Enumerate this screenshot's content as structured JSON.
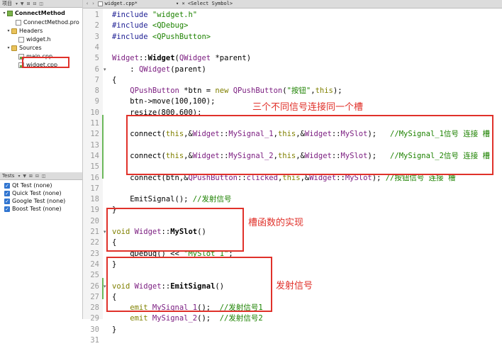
{
  "projects_panel": {
    "header_title": "项目",
    "tree": [
      {
        "label": "ConnectMethod",
        "kind": "project",
        "bold": true,
        "arrow": "▾"
      },
      {
        "label": "ConnectMethod.pro",
        "kind": "file",
        "arrow": ""
      },
      {
        "label": "Headers",
        "kind": "folder",
        "arrow": "▾"
      },
      {
        "label": "widget.h",
        "kind": "file",
        "arrow": ""
      },
      {
        "label": "Sources",
        "kind": "folder",
        "arrow": "▾"
      },
      {
        "label": "main.cpp",
        "kind": "cpp",
        "arrow": ""
      },
      {
        "label": "widget.cpp",
        "kind": "cpp",
        "arrow": "",
        "selected": true
      }
    ]
  },
  "tests_panel": {
    "header_title": "Tests",
    "items": [
      {
        "label": "Qt Test (none)"
      },
      {
        "label": "Quick Test (none)"
      },
      {
        "label": "Google Test (none)"
      },
      {
        "label": "Boost Test (none)"
      }
    ]
  },
  "editor": {
    "filename": "widget.cpp*",
    "symbol_selector": "<Select Symbol>",
    "close_glyph": "×",
    "lines": [
      [
        [
          "#include ",
          "#1d1e93"
        ],
        [
          "\"widget.h\"",
          "#1d8200"
        ]
      ],
      [
        [
          "#include ",
          "#1d1e93"
        ],
        [
          "<QDebug>",
          "#1d8200"
        ]
      ],
      [
        [
          "#include ",
          "#1d1e93"
        ],
        [
          "<QPushButton>",
          "#1d8200"
        ]
      ],
      [
        [
          "",
          ""
        ]
      ],
      [
        [
          "Widget",
          "#7a1b7f"
        ],
        [
          "::",
          "#000"
        ],
        [
          "Widget",
          "#000",
          "bold"
        ],
        [
          "(",
          "#000"
        ],
        [
          "QWidget",
          "#7a1b7f"
        ],
        [
          " *parent)",
          "#000"
        ]
      ],
      [
        [
          "    : ",
          "#000"
        ],
        [
          "QWidget",
          "#7a1b7f"
        ],
        [
          "(parent)",
          "#000"
        ]
      ],
      [
        [
          "{",
          "#000"
        ]
      ],
      [
        [
          "    ",
          "#000"
        ],
        [
          "QPushButton",
          "#7a1b7f"
        ],
        [
          " *btn = ",
          "#000"
        ],
        [
          "new ",
          "#808000"
        ],
        [
          "QPushButton",
          "#7a1b7f"
        ],
        [
          "(",
          "#000"
        ],
        [
          "\"按钮\"",
          "#1d8200"
        ],
        [
          ",",
          "#000"
        ],
        [
          "this",
          "#808000"
        ],
        [
          ");",
          "#000"
        ]
      ],
      [
        [
          "    btn->move(100,100);",
          "#000"
        ]
      ],
      [
        [
          "    resize(800,600);",
          "#000"
        ]
      ],
      [
        [
          "",
          ""
        ]
      ],
      [
        [
          "    connect(",
          "#000"
        ],
        [
          "this",
          "#808000"
        ],
        [
          ",&",
          "#000"
        ],
        [
          "Widget",
          "#7a1b7f"
        ],
        [
          "::",
          "#000"
        ],
        [
          "MySignal_1",
          "#7a1b7f"
        ],
        [
          ",",
          "#000"
        ],
        [
          "this",
          "#808000"
        ],
        [
          ",&",
          "#000"
        ],
        [
          "Widget",
          "#7a1b7f"
        ],
        [
          "::",
          "#000"
        ],
        [
          "MySlot",
          "#7a1b7f"
        ],
        [
          ");   ",
          "#000"
        ],
        [
          "//MySignal_1信号 连接 槽",
          "#1d8200"
        ]
      ],
      [
        [
          "",
          ""
        ]
      ],
      [
        [
          "    connect(",
          "#000"
        ],
        [
          "this",
          "#808000"
        ],
        [
          ",&",
          "#000"
        ],
        [
          "Widget",
          "#7a1b7f"
        ],
        [
          "::",
          "#000"
        ],
        [
          "MySignal_2",
          "#7a1b7f"
        ],
        [
          ",",
          "#000"
        ],
        [
          "this",
          "#808000"
        ],
        [
          ",&",
          "#000"
        ],
        [
          "Widget",
          "#7a1b7f"
        ],
        [
          "::",
          "#000"
        ],
        [
          "MySlot",
          "#7a1b7f"
        ],
        [
          ");   ",
          "#000"
        ],
        [
          "//MySignal_2信号 连接 槽",
          "#1d8200"
        ]
      ],
      [
        [
          "",
          ""
        ]
      ],
      [
        [
          "    connect(btn,&",
          "#000"
        ],
        [
          "QPushButton",
          "#7a1b7f"
        ],
        [
          "::",
          "#000"
        ],
        [
          "clicked",
          "#7a1b7f"
        ],
        [
          ",",
          "#000"
        ],
        [
          "this",
          "#808000"
        ],
        [
          ",&",
          "#000"
        ],
        [
          "Widget",
          "#7a1b7f"
        ],
        [
          "::",
          "#000"
        ],
        [
          "MySlot",
          "#7a1b7f"
        ],
        [
          "); ",
          "#000"
        ],
        [
          "//按钮信号 连接 槽",
          "#1d8200"
        ]
      ],
      [
        [
          "",
          ""
        ]
      ],
      [
        [
          "    EmitSignal(); ",
          "#000"
        ],
        [
          "//发射信号",
          "#1d8200"
        ]
      ],
      [
        [
          "}",
          "#000"
        ]
      ],
      [
        [
          "",
          ""
        ]
      ],
      [
        [
          "void ",
          "#808000"
        ],
        [
          "Widget",
          "#7a1b7f"
        ],
        [
          "::",
          "#000"
        ],
        [
          "MySlot",
          "#000",
          "bold"
        ],
        [
          "()",
          "#000"
        ]
      ],
      [
        [
          "{",
          "#000"
        ]
      ],
      [
        [
          "    qDebug() << ",
          "#000"
        ],
        [
          "\"MySlot_1\"",
          "#1d8200"
        ],
        [
          ";",
          "#000"
        ]
      ],
      [
        [
          "}",
          "#000"
        ]
      ],
      [
        [
          "",
          ""
        ]
      ],
      [
        [
          "void ",
          "#808000"
        ],
        [
          "Widget",
          "#7a1b7f"
        ],
        [
          "::",
          "#000"
        ],
        [
          "EmitSignal",
          "#000",
          "bold"
        ],
        [
          "()",
          "#000"
        ]
      ],
      [
        [
          "{",
          "#000"
        ]
      ],
      [
        [
          "    emit ",
          "#808000"
        ],
        [
          "MySignal_1",
          "#7a1b7f"
        ],
        [
          "();  ",
          "#000"
        ],
        [
          "//发射信号1",
          "#1d8200"
        ]
      ],
      [
        [
          "    emit ",
          "#808000"
        ],
        [
          "MySignal_2",
          "#7a1b7f"
        ],
        [
          "();  ",
          "#000"
        ],
        [
          "//发射信号2",
          "#1d8200"
        ]
      ],
      [
        [
          "}",
          "#000"
        ]
      ],
      [
        [
          "",
          ""
        ]
      ]
    ],
    "fold_markers": {
      "6": "▾",
      "21": "▾",
      "26": "▾"
    }
  },
  "annotations": {
    "connect_title": "三个不同信号连接同一个槽",
    "slot_impl": "槽函数的实现",
    "emit_signal": "发射信号"
  },
  "colors": {
    "accent": "#e0312a",
    "comment": "#1d8200",
    "keyword": "#808000",
    "type": "#7a1b7f"
  }
}
